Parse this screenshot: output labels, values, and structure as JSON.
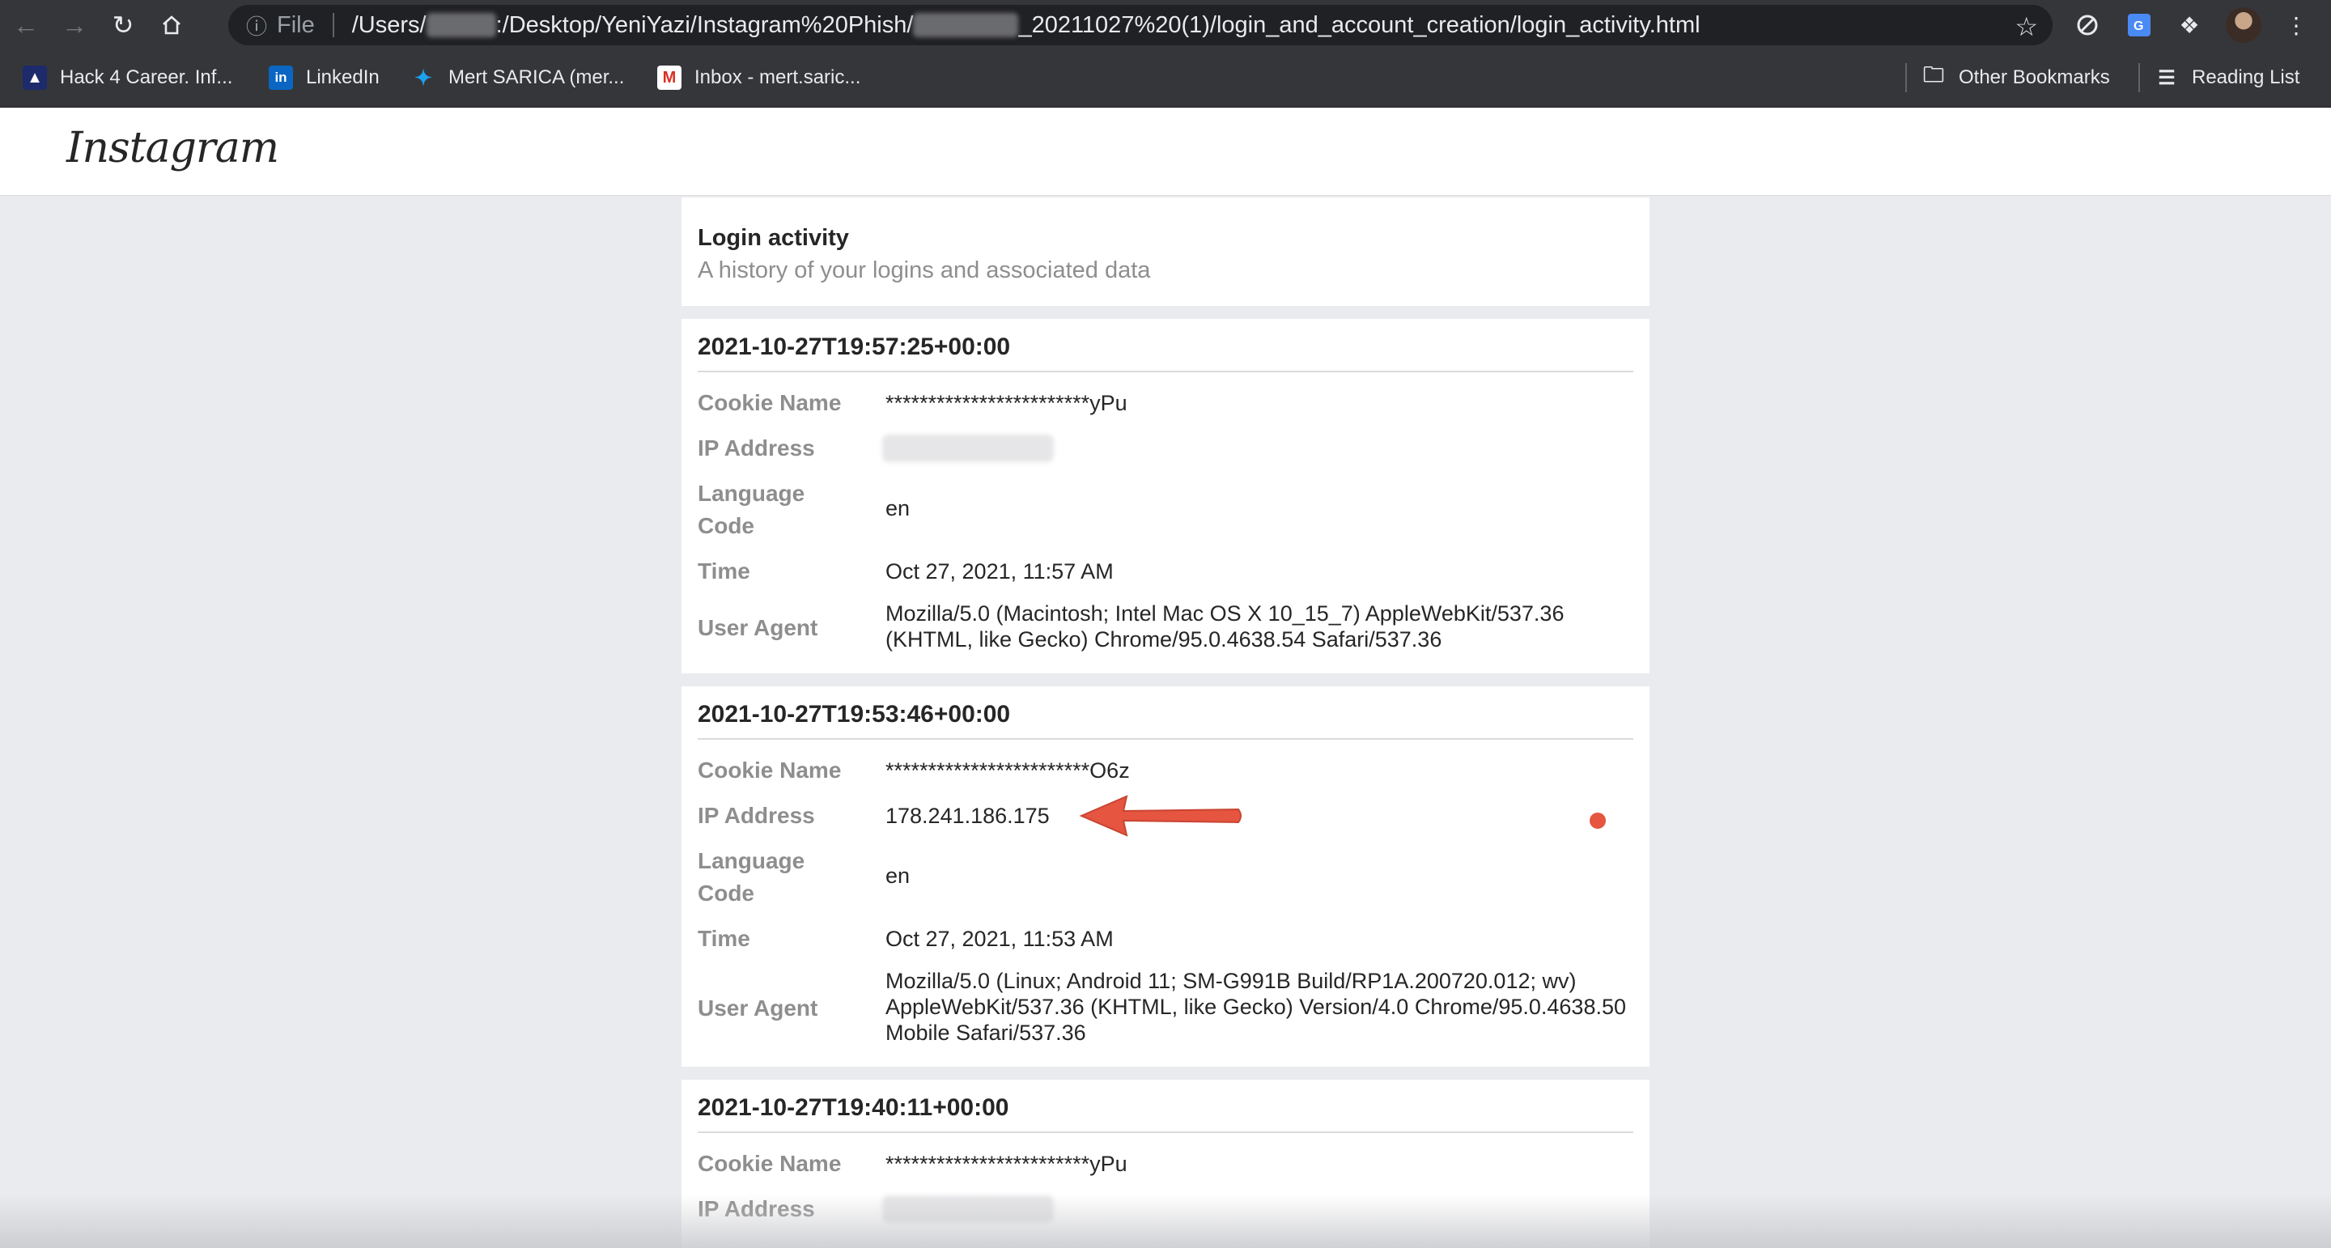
{
  "browser": {
    "url_scheme": "File",
    "url_part1": "/Users/",
    "url_part2": ":/Desktop/YeniYazi/Instagram%20Phish/",
    "url_part3": "_20211027%20(1)/login_and_account_creation/login_activity.html",
    "bookmarks": [
      {
        "label": "Hack 4 Career. Inf...",
        "icon": "hack4career-icon"
      },
      {
        "label": "LinkedIn",
        "icon": "linkedin-icon"
      },
      {
        "label": "Mert SARICA (mer...",
        "icon": "twitter-icon"
      },
      {
        "label": "Inbox - mert.saric...",
        "icon": "gmail-icon"
      }
    ],
    "other_bookmarks": "Other Bookmarks",
    "reading_list": "Reading List"
  },
  "page": {
    "logo": "Instagram",
    "header_title": "Login activity",
    "header_subtitle": "A history of your logins and associated data",
    "labels": {
      "cookie": "Cookie Name",
      "ip": "IP Address",
      "lang1": "Language",
      "lang2": "Code",
      "time": "Time",
      "ua": "User Agent"
    },
    "entries": [
      {
        "timestamp": "2021-10-27T19:57:25+00:00",
        "cookie": "************************yPu",
        "ip": "",
        "language": "en",
        "time": "Oct 27, 2021, 11:57 AM",
        "user_agent_l1": "Mozilla/5.0 (Macintosh; Intel Mac OS X 10_15_7) AppleWebKit/537.36",
        "user_agent_l2": "(KHTML, like Gecko) Chrome/95.0.4638.54 Safari/537.36"
      },
      {
        "timestamp": "2021-10-27T19:53:46+00:00",
        "cookie": "************************O6z",
        "ip": "178.241.186.175",
        "language": "en",
        "time": "Oct 27, 2021, 11:53 AM",
        "user_agent_l1": "Mozilla/5.0 (Linux; Android 11; SM-G991B Build/RP1A.200720.012; wv)",
        "user_agent_l2": "AppleWebKit/537.36 (KHTML, like Gecko) Version/4.0 Chrome/95.0.4638.50",
        "user_agent_l3": "Mobile Safari/537.36"
      },
      {
        "timestamp": "2021-10-27T19:40:11+00:00",
        "cookie": "************************yPu",
        "ip": ""
      }
    ]
  },
  "colors": {
    "annotation": "#e5553f",
    "chrome": "#35363a",
    "page_bg": "#eaebee"
  }
}
